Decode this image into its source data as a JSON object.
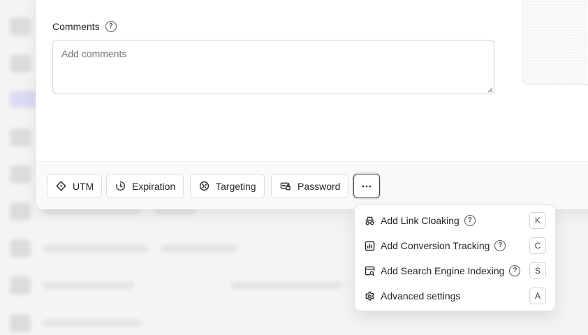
{
  "comments": {
    "label": "Comments",
    "placeholder": "Add comments"
  },
  "toolbar": {
    "utm_label": "UTM",
    "expiration_label": "Expiration",
    "targeting_label": "Targeting",
    "password_label": "Password",
    "more_icon": "ellipsis-icon"
  },
  "menu": {
    "items": [
      {
        "label": "Add Link Cloaking",
        "shortcut": "K",
        "icon": "incognito-icon",
        "help": true
      },
      {
        "label": "Add Conversion Tracking",
        "shortcut": "C",
        "icon": "chart-icon",
        "help": true
      },
      {
        "label": "Add Search Engine Indexing",
        "shortcut": "S",
        "icon": "search-window-icon",
        "help": true
      },
      {
        "label": "Advanced settings",
        "shortcut": "A",
        "icon": "gear-icon",
        "help": false
      }
    ]
  },
  "colors": {
    "text": "#262626",
    "border": "#dedede",
    "accent_background": "#c7c6f2"
  }
}
